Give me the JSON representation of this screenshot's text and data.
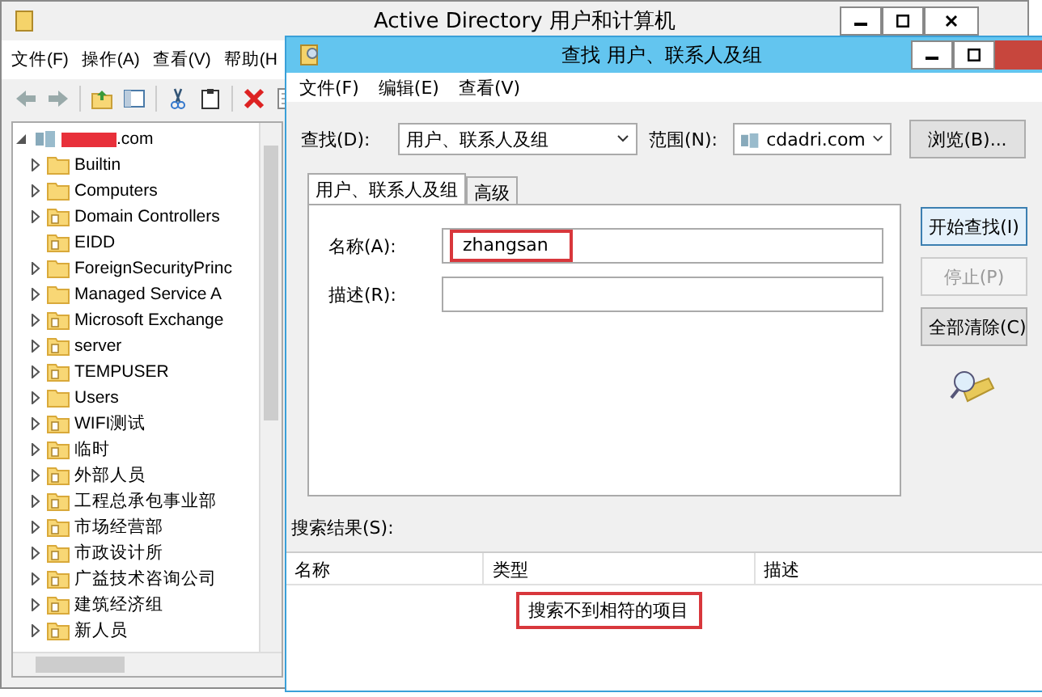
{
  "main_window": {
    "title": "Active Directory 用户和计算机",
    "menu": [
      "文件(F)",
      "操作(A)",
      "查看(V)",
      "帮助(H"
    ],
    "tree": {
      "label": ".com",
      "redacted": true,
      "expanded": true,
      "children": [
        {
          "label": "Builtin",
          "kind": "container",
          "expandable": true
        },
        {
          "label": "Computers",
          "kind": "container",
          "expandable": true
        },
        {
          "label": "Domain Controllers",
          "kind": "ou",
          "expandable": true
        },
        {
          "label": "EIDD",
          "kind": "ou",
          "expandable": false
        },
        {
          "label": "ForeignSecurityPrinc",
          "kind": "container",
          "expandable": true
        },
        {
          "label": "Managed Service A",
          "kind": "container",
          "expandable": true
        },
        {
          "label": "Microsoft Exchange",
          "kind": "ou",
          "expandable": true
        },
        {
          "label": "server",
          "kind": "ou",
          "expandable": true
        },
        {
          "label": "TEMPUSER",
          "kind": "ou",
          "expandable": true
        },
        {
          "label": "Users",
          "kind": "container",
          "expandable": true
        },
        {
          "label": "WIFI测试",
          "kind": "ou",
          "expandable": true
        },
        {
          "label": "临时",
          "kind": "ou",
          "expandable": true
        },
        {
          "label": "外部人员",
          "kind": "ou",
          "expandable": true
        },
        {
          "label": "工程总承包事业部",
          "kind": "ou",
          "expandable": true
        },
        {
          "label": "市场经营部",
          "kind": "ou",
          "expandable": true
        },
        {
          "label": "市政设计所",
          "kind": "ou",
          "expandable": true
        },
        {
          "label": "广益技术咨询公司",
          "kind": "ou",
          "expandable": true
        },
        {
          "label": "建筑经济组",
          "kind": "ou",
          "expandable": true
        },
        {
          "label": "新人员",
          "kind": "ou",
          "expandable": true
        }
      ]
    }
  },
  "find_dialog": {
    "title": "查找 用户、联系人及组",
    "menu": [
      "文件(F)",
      "编辑(E)",
      "查看(V)"
    ],
    "find_label": "查找(D):",
    "find_value": "用户、联系人及组",
    "scope_label": "范围(N):",
    "scope_value": "cdadri.com",
    "browse_button": "浏览(B)...",
    "tabs": [
      {
        "label": "用户、联系人及组",
        "selected": true
      },
      {
        "label": "高级",
        "selected": false
      }
    ],
    "fields": [
      {
        "label": "名称(A):",
        "value": "zhangsan",
        "highlighted": true
      },
      {
        "label": "描述(R):",
        "highlighted": false
      }
    ],
    "buttons": [
      {
        "label": "开始查找(I)",
        "disabled": false
      },
      {
        "label": "停止(P)",
        "disabled": true
      },
      {
        "label": "全部清除(C)",
        "disabled": false
      }
    ],
    "results_label": "搜索结果(S):",
    "columns": [
      "名称",
      "类型",
      "描述"
    ],
    "empty_message": {
      "text": "搜索不到相符的项目",
      "highlighted": true
    }
  }
}
